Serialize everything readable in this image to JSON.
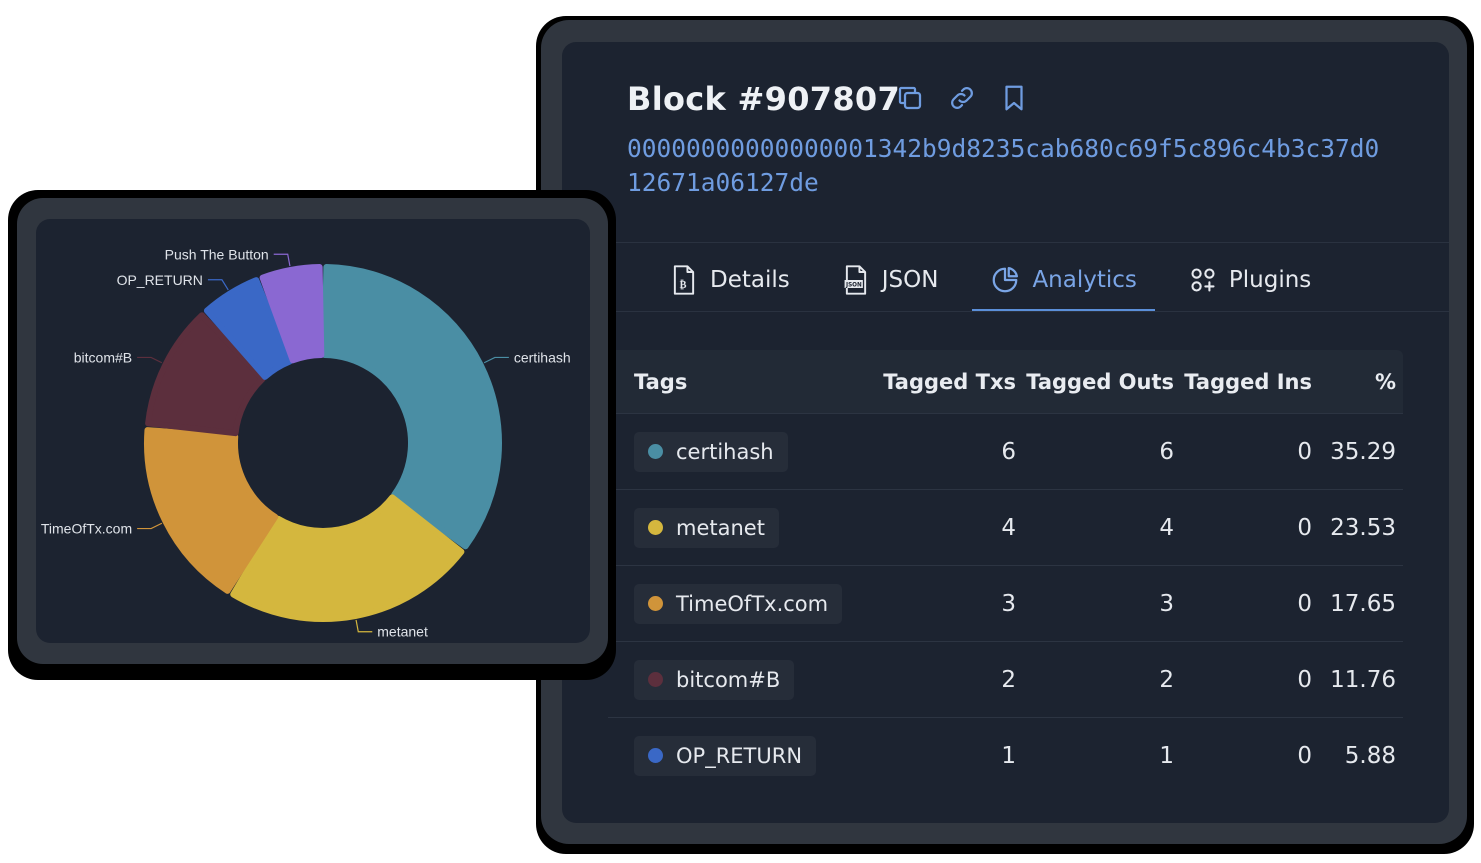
{
  "block": {
    "title": "Block #907807",
    "hash": "00000000000000001342b9d8235cab680c69f5c896c4b3c37d012671a06127de",
    "icons": [
      "copy-icon",
      "link-icon",
      "bookmark-icon"
    ]
  },
  "tabs": [
    {
      "label": "Details",
      "icon": "document-bitcoin-icon",
      "active": false
    },
    {
      "label": "JSON",
      "icon": "json-file-icon",
      "active": false
    },
    {
      "label": "Analytics",
      "icon": "pie-chart-icon",
      "active": true
    },
    {
      "label": "Plugins",
      "icon": "apps-grid-icon",
      "active": false
    }
  ],
  "table": {
    "headers": {
      "tags": "Tags",
      "txs": "Tagged Txs",
      "outs": "Tagged Outs",
      "ins": "Tagged Ins",
      "pct": "%"
    },
    "rows": [
      {
        "tag": "certihash",
        "color": "#4a8ea4",
        "txs": "6",
        "outs": "6",
        "ins": "0",
        "pct": "35.29"
      },
      {
        "tag": "metanet",
        "color": "#d4b73e",
        "txs": "4",
        "outs": "4",
        "ins": "0",
        "pct": "23.53"
      },
      {
        "tag": "TimeOfTx.com",
        "color": "#d0943a",
        "txs": "3",
        "outs": "3",
        "ins": "0",
        "pct": "17.65"
      },
      {
        "tag": "bitcom#B",
        "color": "#5c2f3d",
        "txs": "2",
        "outs": "2",
        "ins": "0",
        "pct": "11.76"
      },
      {
        "tag": "OP_RETURN",
        "color": "#3a68c6",
        "txs": "1",
        "outs": "1",
        "ins": "0",
        "pct": "5.88"
      }
    ]
  },
  "chart_data": {
    "type": "pie",
    "variant": "donut",
    "labels": [
      "certihash",
      "metanet",
      "TimeOfTx.com",
      "bitcom#B",
      "OP_RETURN",
      "Push The Button"
    ],
    "values": [
      6,
      4,
      3,
      2,
      1,
      1
    ],
    "colors": [
      "#4a8ea4",
      "#d4b73e",
      "#d0943a",
      "#5c2f3d",
      "#3a68c6",
      "#8a68d2"
    ]
  }
}
